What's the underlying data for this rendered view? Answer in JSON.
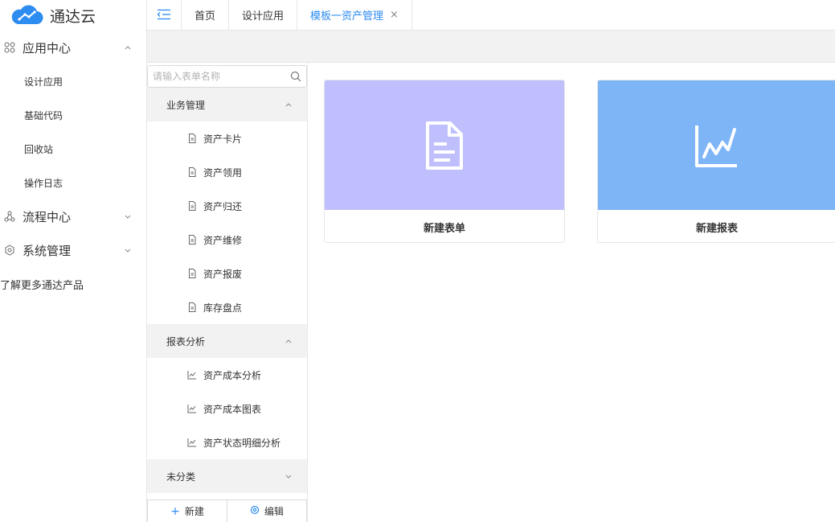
{
  "app": {
    "name": "通达云"
  },
  "sidebar": {
    "groups": [
      {
        "label": "应用中心",
        "items": [
          "设计应用",
          "基础代码",
          "回收站",
          "操作日志"
        ]
      },
      {
        "label": "流程中心"
      },
      {
        "label": "系统管理"
      }
    ],
    "more_link": "了解更多通达产品"
  },
  "tabs": [
    {
      "label": "首页"
    },
    {
      "label": "设计应用"
    },
    {
      "label": "模板一资产管理"
    }
  ],
  "panel": {
    "search_placeholder": "请输入表单名称",
    "categories": [
      {
        "label": "业务管理",
        "items": [
          "资产卡片",
          "资产领用",
          "资产归还",
          "资产维修",
          "资产报废",
          "库存盘点"
        ]
      },
      {
        "label": "报表分析",
        "items": [
          "资产成本分析",
          "资产成本图表",
          "资产状态明细分析"
        ]
      },
      {
        "label": "未分类"
      }
    ],
    "new_label": "新建",
    "edit_label": "编辑"
  },
  "cards": [
    {
      "label": "新建表单",
      "color": "#c0bffe"
    },
    {
      "label": "新建报表",
      "color": "#7db5f7"
    }
  ],
  "colors": {
    "accent": "#2d8cf0",
    "logo": "#2d8cf0"
  }
}
